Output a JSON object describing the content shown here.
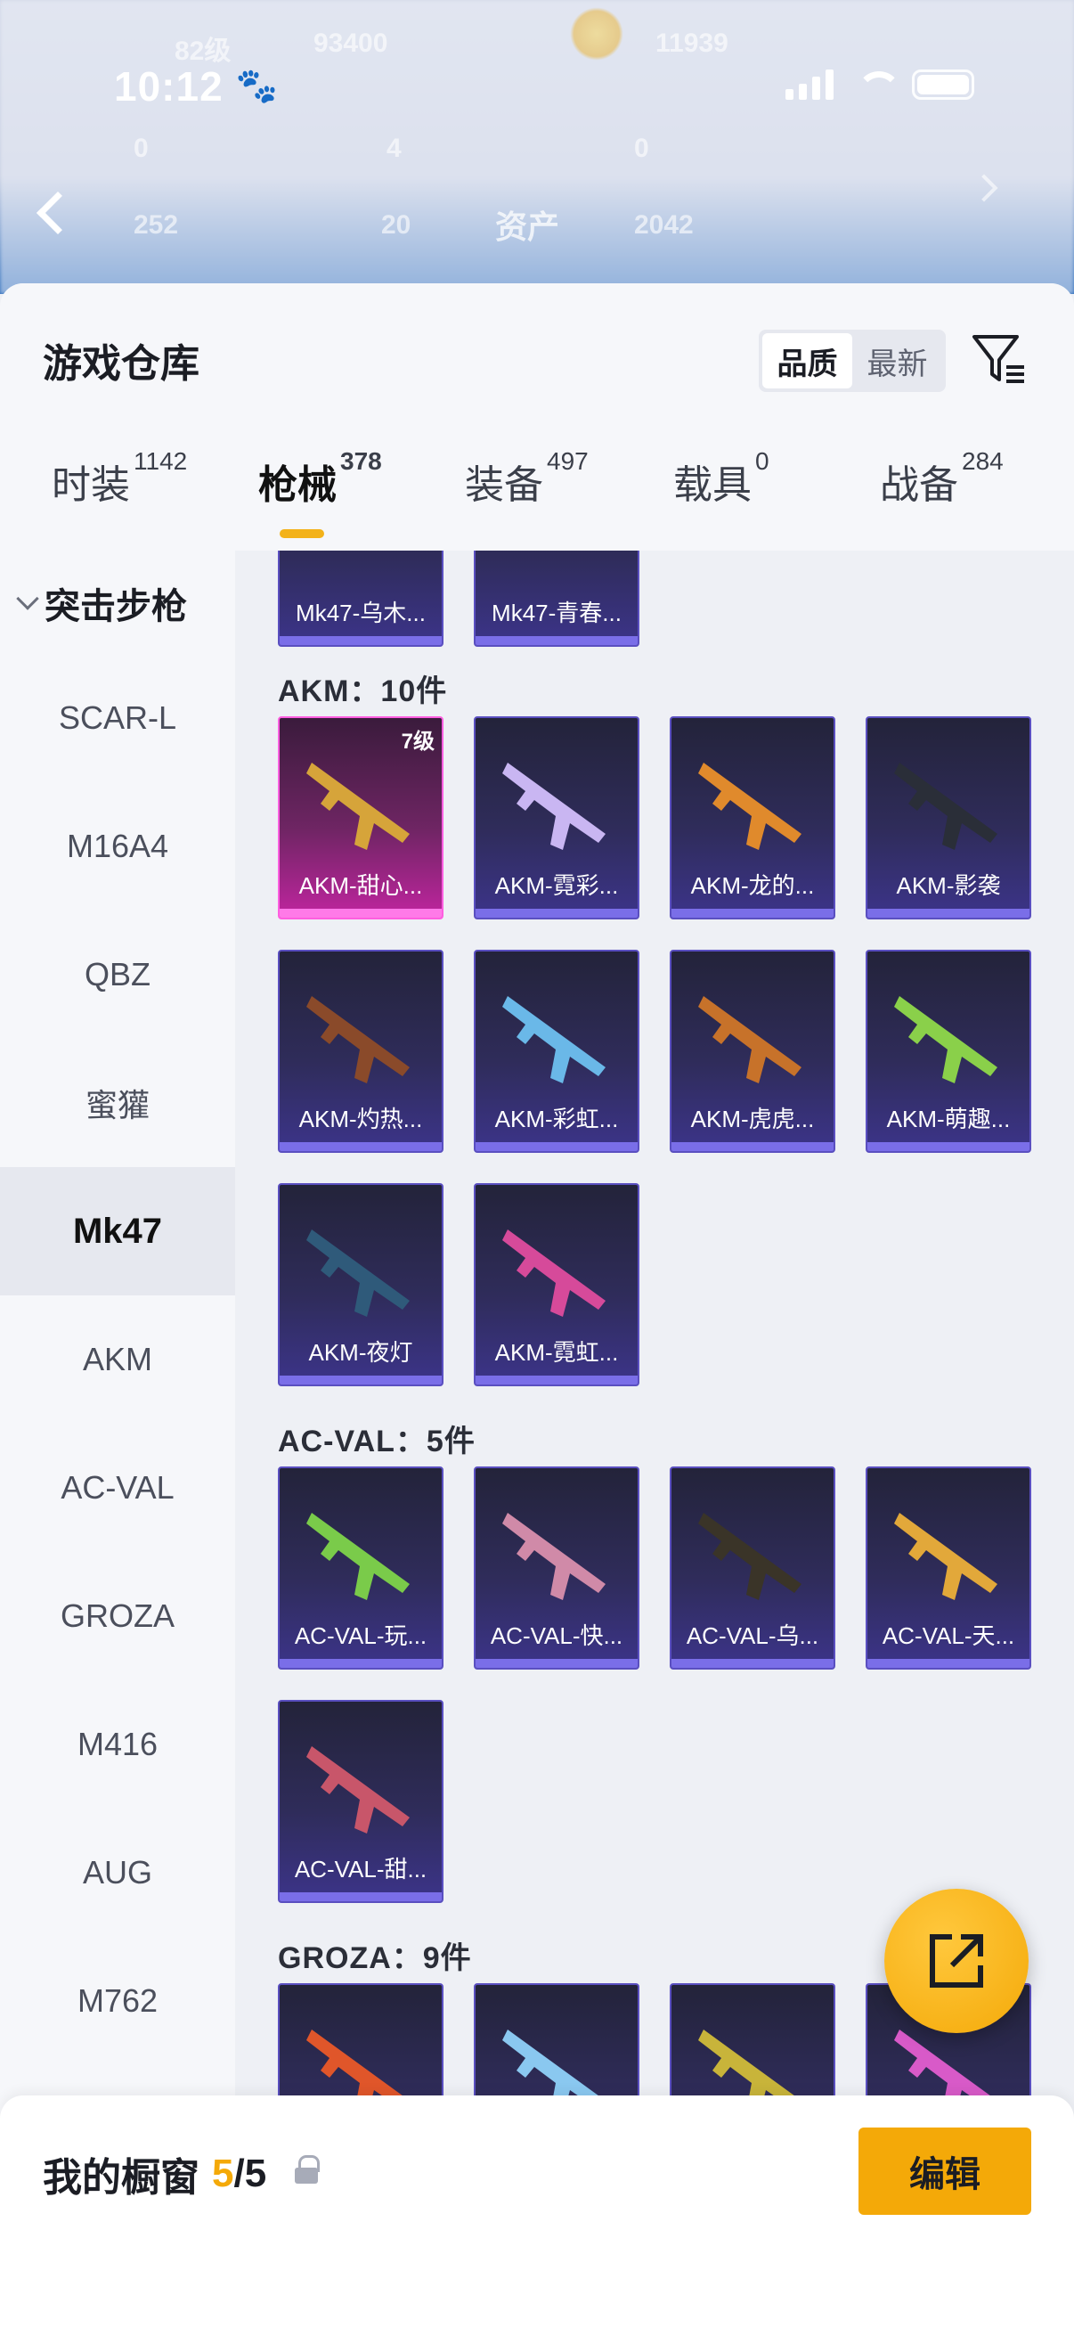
{
  "status_bar": {
    "time": "10:12",
    "paw_icon": "🐾"
  },
  "background_header": {
    "level": "82级",
    "coins": "93400",
    "points": "11939",
    "stat_a": "0",
    "stat_b": "4",
    "stat_c": "0",
    "stat_d": "252",
    "stat_e": "20",
    "page_label": "资产",
    "stat_f": "2042"
  },
  "sheet": {
    "title": "游戏仓库",
    "sort": {
      "quality": "品质",
      "newest": "最新"
    }
  },
  "tabs": [
    {
      "label": "时装",
      "count": "1142"
    },
    {
      "label": "枪械",
      "count": "378"
    },
    {
      "label": "装备",
      "count": "497"
    },
    {
      "label": "载具",
      "count": "0"
    },
    {
      "label": "战备",
      "count": "284"
    }
  ],
  "sidebar": {
    "category": "突击步枪",
    "items": [
      "SCAR-L",
      "M16A4",
      "QBZ",
      "蜜獾",
      "Mk47",
      "AKM",
      "AC-VAL",
      "GROZA",
      "M416",
      "AUG",
      "M762"
    ],
    "selected": "Mk47"
  },
  "sections": {
    "top_cards": [
      "Mk47-乌木...",
      "Mk47-青春..."
    ],
    "akm": {
      "title": "AKM：10件",
      "cards": [
        {
          "label": "AKM-甜心...",
          "level": "7级"
        },
        {
          "label": "AKM-霓彩..."
        },
        {
          "label": "AKM-龙的..."
        },
        {
          "label": "AKM-影袭"
        },
        {
          "label": "AKM-灼热..."
        },
        {
          "label": "AKM-彩虹..."
        },
        {
          "label": "AKM-虎虎..."
        },
        {
          "label": "AKM-萌趣..."
        },
        {
          "label": "AKM-夜灯"
        },
        {
          "label": "AKM-霓虹..."
        }
      ]
    },
    "acval": {
      "title": "AC-VAL：5件",
      "cards": [
        {
          "label": "AC-VAL-玩..."
        },
        {
          "label": "AC-VAL-快..."
        },
        {
          "label": "AC-VAL-乌..."
        },
        {
          "label": "AC-VAL-天..."
        },
        {
          "label": "AC-VAL-甜..."
        }
      ]
    },
    "groza": {
      "title": "GROZA：9件"
    }
  },
  "bottom": {
    "showcase_label": "我的橱窗",
    "current": "5",
    "total": "/5",
    "edit": "编辑"
  },
  "colors": {
    "accent": "#f4a908",
    "card_border": "#5a4fc0",
    "card_highlight": "#ff5ee0"
  }
}
